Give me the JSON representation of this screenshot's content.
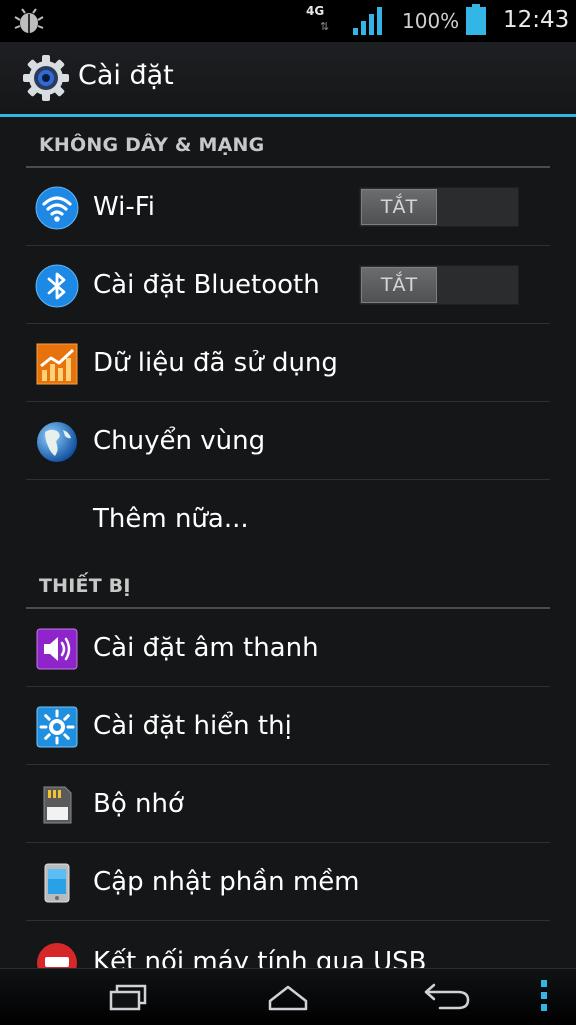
{
  "status_bar": {
    "network_type": "4G",
    "network_activity": "⇅",
    "battery_percent": "100%",
    "time": "12:43",
    "icons": [
      "bug-icon",
      "signal-icon",
      "battery-icon"
    ]
  },
  "action_bar": {
    "title": "Cài đặt",
    "icon": "settings-gear-icon",
    "accent_color": "#33b5e5"
  },
  "sections": {
    "wireless": {
      "header": "KHÔNG DÂY & MẠNG",
      "items": [
        {
          "label": "Wi-Fi",
          "icon": "wifi-icon",
          "toggle": "TẮT"
        },
        {
          "label": "Cài đặt Bluetooth",
          "icon": "bluetooth-icon",
          "toggle": "TẮT"
        },
        {
          "label": "Dữ liệu đã sử dụng",
          "icon": "data-usage-icon"
        },
        {
          "label": "Chuyển vùng",
          "icon": "globe-icon"
        },
        {
          "label": "Thêm nữa..."
        }
      ]
    },
    "device": {
      "header": "THIẾT BỊ",
      "items": [
        {
          "label": "Cài đặt âm thanh",
          "icon": "sound-icon"
        },
        {
          "label": "Cài đặt hiển thị",
          "icon": "display-icon"
        },
        {
          "label": "Bộ nhớ",
          "icon": "storage-icon"
        },
        {
          "label": "Cập nhật phần mềm",
          "icon": "phone-update-icon"
        },
        {
          "label": "Kết nối máy tính qua USB",
          "icon": "usb-icon"
        }
      ]
    }
  },
  "nav_bar": {
    "buttons": [
      "recent-apps-icon",
      "home-icon",
      "back-icon",
      "menu-icon"
    ]
  }
}
